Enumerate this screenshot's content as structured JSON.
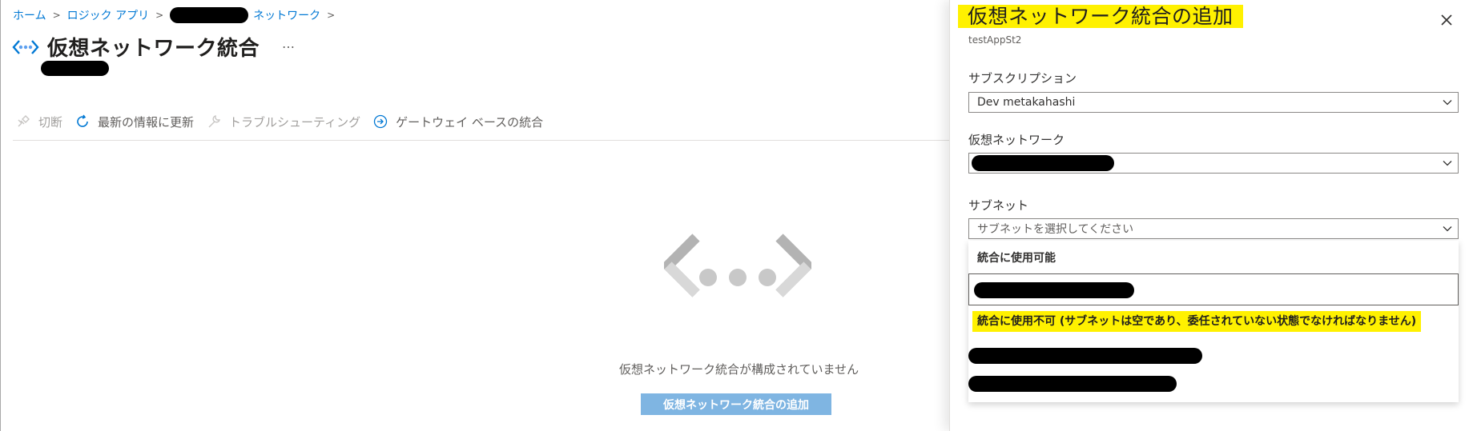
{
  "breadcrumb": {
    "items": [
      "ホーム",
      "ロジック アプリ",
      "ネットワーク"
    ],
    "separator": ">"
  },
  "page": {
    "title": "仮想ネットワーク統合",
    "more": "…"
  },
  "toolbar": {
    "disconnect": "切断",
    "refresh": "最新の情報に更新",
    "troubleshoot": "トラブルシューティング",
    "gateway": "ゲートウェイ ベースの統合"
  },
  "empty_state": {
    "message": "仮想ネットワーク統合が構成されていません",
    "button": "仮想ネットワーク統合の追加"
  },
  "panel": {
    "title": "仮想ネットワーク統合の追加",
    "subtitle": "testAppSt2",
    "subscription_label": "サブスクリプション",
    "subscription_value": "Dev metakahashi",
    "vnet_label": "仮想ネットワーク",
    "subnet_label": "サブネット",
    "subnet_placeholder": "サブネットを選択してください",
    "dropdown": {
      "available_header": "統合に使用可能",
      "unavailable_header": "統合に使用不可 (サブネットは空であり、委任されていない状態でなければなりません)"
    }
  },
  "colors": {
    "link": "#0078d4",
    "highlight": "#fff100",
    "primary_button_disabled": "#7fb5e2"
  },
  "icons": [
    "vnet-icon",
    "unplug-icon",
    "refresh-icon",
    "wrench-icon",
    "arrow-circle-icon",
    "close-icon",
    "chevron-down-icon"
  ]
}
